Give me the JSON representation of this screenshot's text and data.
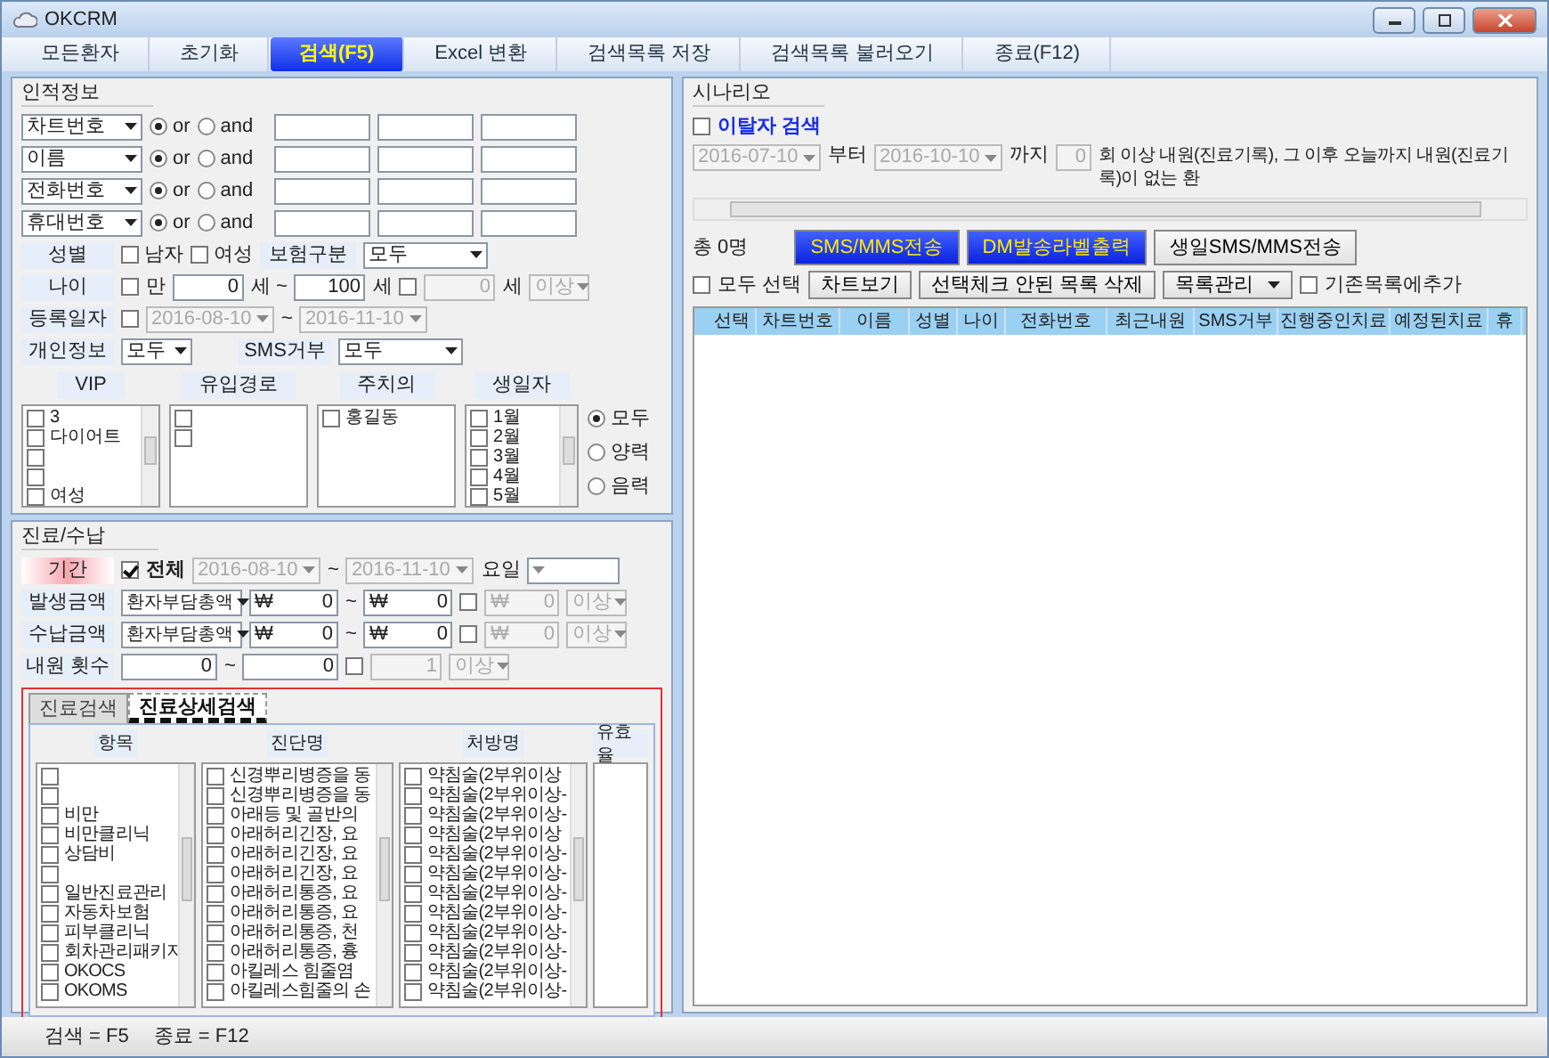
{
  "window": {
    "title": "OKCRM"
  },
  "toolbar": [
    {
      "label": "모든환자",
      "selected": false
    },
    {
      "label": "초기화",
      "selected": false
    },
    {
      "label": "검색(F5)",
      "selected": true
    },
    {
      "label": "Excel 변환",
      "selected": false
    },
    {
      "label": "검색목록 저장",
      "selected": false
    },
    {
      "label": "검색목록 불러오기",
      "selected": false
    },
    {
      "label": "종료(F12)",
      "selected": false
    }
  ],
  "personal": {
    "title": "인적정보",
    "search_rows": [
      {
        "field": "차트번호",
        "modes": [
          {
            "label": "or",
            "selected": true
          },
          {
            "label": "and",
            "selected": false
          }
        ]
      },
      {
        "field": "이름",
        "modes": [
          {
            "label": "or",
            "selected": true
          },
          {
            "label": "and",
            "selected": false
          }
        ]
      },
      {
        "field": "전화번호",
        "modes": [
          {
            "label": "or",
            "selected": true
          },
          {
            "label": "and",
            "selected": false
          }
        ]
      },
      {
        "field": "휴대번호",
        "modes": [
          {
            "label": "or",
            "selected": true
          },
          {
            "label": "and",
            "selected": false
          }
        ]
      }
    ],
    "gender": {
      "label": "성별",
      "options": [
        {
          "label": "남자",
          "checked": false
        },
        {
          "label": "여성",
          "checked": false
        }
      ]
    },
    "insurance": {
      "label": "보험구분",
      "value": "모두"
    },
    "age": {
      "label": "나이",
      "full_age": {
        "label": "만",
        "checked": false
      },
      "from": "0",
      "from_unit": "세 ~",
      "to": "100",
      "to_unit": "세",
      "limit": {
        "checked": false,
        "value": "0",
        "unit": "세",
        "mode": "이상"
      }
    },
    "registered": {
      "label": "등록일자",
      "checked": false,
      "from": "2016-08-10",
      "separator": "~",
      "to": "2016-11-10"
    },
    "privacy": {
      "label": "개인정보",
      "value": "모두"
    },
    "sms_refusal": {
      "label": "SMS거부",
      "value": "모두"
    },
    "lists": [
      {
        "title": "VIP",
        "scrollbar": true,
        "items": [
          {
            "label": "3",
            "checked": false
          },
          {
            "label": "다이어트",
            "checked": false
          },
          {
            "checked": false
          },
          {
            "checked": false
          },
          {
            "label": "여성",
            "checked": false
          }
        ]
      },
      {
        "title": "유입경로",
        "scrollbar": false,
        "items": [
          {
            "checked": false
          },
          {
            "checked": false
          }
        ]
      },
      {
        "title": "주치의",
        "scrollbar": false,
        "items": [
          {
            "label": "홍길동",
            "checked": false
          }
        ]
      },
      {
        "title": "생일자",
        "scrollbar": true,
        "items": [
          {
            "label": "1월",
            "checked": false
          },
          {
            "label": "2월",
            "checked": false
          },
          {
            "label": "3월",
            "checked": false
          },
          {
            "label": "4월",
            "checked": false
          },
          {
            "label": "5월",
            "checked": false
          }
        ]
      }
    ],
    "birth_modes": [
      {
        "label": "모두",
        "selected": true
      },
      {
        "label": "양력",
        "selected": false
      },
      {
        "label": "음력",
        "selected": false
      }
    ]
  },
  "treatment": {
    "title": "진료/수납",
    "period": {
      "label": "기간",
      "all": {
        "label": "전체",
        "checked": true
      },
      "from": "2016-08-10",
      "separator": "~",
      "to": "2016-11-10",
      "weekday_label": "요일"
    },
    "amount_rows": [
      {
        "label": "발생금액",
        "type": "환자부담총액",
        "from": {
          "currency": "₩",
          "value": "0"
        },
        "separator": "~",
        "to": {
          "currency": "₩",
          "value": "0"
        },
        "limit": {
          "checked": false,
          "currency": "₩",
          "value": "0",
          "mode": "이상"
        }
      },
      {
        "label": "수납금액",
        "type": "환자부담총액",
        "from": {
          "currency": "₩",
          "value": "0"
        },
        "separator": "~",
        "to": {
          "currency": "₩",
          "value": "0"
        },
        "limit": {
          "checked": false,
          "currency": "₩",
          "value": "0",
          "mode": "이상"
        }
      }
    ],
    "visits": {
      "label": "내원 횟수",
      "from": "0",
      "separator": "~",
      "to": "0",
      "limit": {
        "checked": false,
        "value": "1",
        "mode": "이상"
      }
    },
    "tabs": [
      {
        "label": "진료검색",
        "selected": false
      },
      {
        "label": "진료상세검색",
        "selected": true
      }
    ],
    "detail_lists": [
      {
        "title": "항목",
        "scrollbar": true,
        "items": [
          {
            "checked": false
          },
          {
            "checked": false
          },
          {
            "label": "비만",
            "checked": false
          },
          {
            "label": "비만클리닉",
            "checked": false
          },
          {
            "label": "상담비",
            "checked": false
          },
          {
            "checked": false
          },
          {
            "label": "일반진료관리",
            "checked": false
          },
          {
            "label": "자동차보험",
            "checked": false
          },
          {
            "label": "피부클리닉",
            "checked": false
          },
          {
            "label": "회차관리패키지",
            "checked": false
          },
          {
            "label": "OKOCS",
            "checked": false
          },
          {
            "label": "OKOMS",
            "checked": false
          }
        ]
      },
      {
        "title": "진단명",
        "scrollbar": true,
        "items": [
          {
            "label": "신경뿌리병증을 동",
            "checked": false
          },
          {
            "label": "신경뿌리병증을 동",
            "checked": false
          },
          {
            "label": "아래등 및 골반의",
            "checked": false
          },
          {
            "label": "아래허리긴장, 요",
            "checked": false
          },
          {
            "label": "아래허리긴장, 요",
            "checked": false
          },
          {
            "label": "아래허리긴장, 요",
            "checked": false
          },
          {
            "label": "아래허리통증, 요",
            "checked": false
          },
          {
            "label": "아래허리통증, 요",
            "checked": false
          },
          {
            "label": "아래허리통증, 천",
            "checked": false
          },
          {
            "label": "아래허리통증, 흉",
            "checked": false
          },
          {
            "label": "아킬레스 힘줄염",
            "checked": false
          },
          {
            "label": "아킬레스힘줄의 손",
            "checked": false
          }
        ]
      },
      {
        "title": "처방명",
        "scrollbar": true,
        "items": [
          {
            "label": "약침술(2부위이상",
            "checked": false
          },
          {
            "label": "약침술(2부위이상-",
            "checked": false
          },
          {
            "label": "약침술(2부위이상-",
            "checked": false
          },
          {
            "label": "약침술(2부위이상",
            "checked": false
          },
          {
            "label": "약침술(2부위이상-",
            "checked": false
          },
          {
            "label": "약침술(2부위이상-",
            "checked": false
          },
          {
            "label": "약침술(2부위이상-",
            "checked": false
          },
          {
            "label": "약침술(2부위이상-",
            "checked": false
          },
          {
            "label": "약침술(2부위이상-",
            "checked": false
          },
          {
            "label": "약침술(2부위이상-",
            "checked": false
          },
          {
            "label": "약침술(2부위이상-",
            "checked": false
          },
          {
            "label": "약침술(2부위이상-",
            "checked": false
          }
        ]
      },
      {
        "title": "유효율",
        "scrollbar": false
      }
    ]
  },
  "scenario": {
    "title": "시나리오",
    "dropout": {
      "label": "이탈자 검색",
      "checked": false
    },
    "from": "2016-07-10",
    "from_suffix": "부터",
    "to": "2016-10-10",
    "to_suffix": "까지",
    "count": "0",
    "description": "회 이상 내원(진료기록), 그 이후 오늘까지 내원(진료기록)이 없는 환",
    "total": "총 0명",
    "buttons": [
      {
        "label": "SMS/MMS전송",
        "kind": "highlight"
      },
      {
        "label": "DM발송라벨출력",
        "kind": "highlight"
      },
      {
        "label": "생일SMS/MMS전송",
        "kind": "normal"
      }
    ],
    "select_all": {
      "label": "모두 선택",
      "checked": false
    },
    "actions": [
      {
        "label": "차트보기",
        "kind": "button"
      },
      {
        "label": "선택체크 안된 목록 삭제",
        "kind": "button"
      },
      {
        "label": "목록관리",
        "kind": "menu"
      }
    ],
    "append": {
      "label": "기존목록에추가",
      "checked": false
    },
    "columns": [
      "선택",
      "차트번호",
      "이름",
      "성별",
      "나이",
      "전화번호",
      "최근내원",
      "SMS거부",
      "진행중인치료",
      "예정된치료",
      "휴"
    ]
  },
  "status_bar": [
    "검색 = F5",
    "종료 = F12"
  ]
}
